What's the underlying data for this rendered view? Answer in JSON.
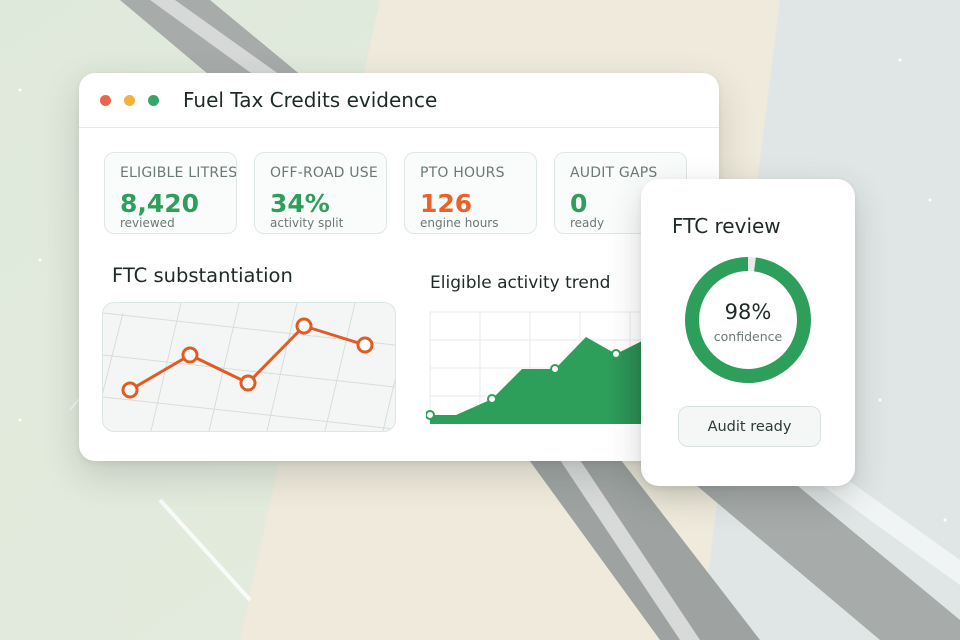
{
  "window": {
    "title": "Fuel Tax Credits evidence",
    "controls": [
      "close",
      "minimize",
      "maximize"
    ]
  },
  "kpis": [
    {
      "label": "ELIGIBLE LITRES",
      "value": "8,420",
      "sub": "reviewed",
      "color": "#2e9e5b"
    },
    {
      "label": "OFF-ROAD USE",
      "value": "34%",
      "sub": "activity split",
      "color": "#2e9e5b"
    },
    {
      "label": "PTO HOURS",
      "value": "126",
      "sub": "engine hours",
      "color": "#e8622a"
    },
    {
      "label": "AUDIT GAPS",
      "value": "0",
      "sub": "ready",
      "color": "#2e9e5b"
    }
  ],
  "substantiation": {
    "title": "FTC substantiation"
  },
  "trend": {
    "title": "Eligible activity trend"
  },
  "review": {
    "title": "FTC review",
    "percent": "98%",
    "percent_value": 0.98,
    "confidence_label": "confidence",
    "button_label": "Audit ready"
  },
  "colors": {
    "accent_green": "#2e9e5b",
    "accent_orange": "#e8622a",
    "dot_red": "#e8664a",
    "dot_yellow": "#f2b23d",
    "dot_green": "#35a66a"
  }
}
